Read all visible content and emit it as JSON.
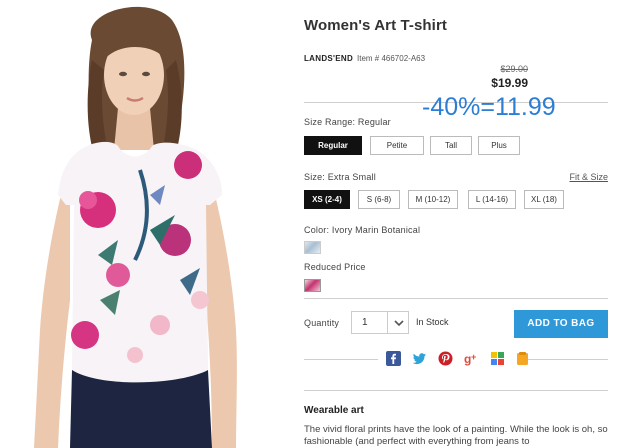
{
  "product": {
    "title": "Women's Art T-shirt",
    "brand": "LANDS'END",
    "item_number": "Item # 466702-A63",
    "original_price": "$29.00",
    "sale_price": "$19.99"
  },
  "overlay": {
    "discount_text": "-40%=11.99",
    "color": "#2b7dd6"
  },
  "size_range": {
    "label": "Size Range: Regular",
    "options": [
      "Regular",
      "Petite",
      "Tall",
      "Plus"
    ],
    "selected": "Regular"
  },
  "size": {
    "label": "Size: Extra Small",
    "fit_link": "Fit & Size",
    "options": [
      "XS (2-4)",
      "S (6-8)",
      "M (10-12)",
      "L (14-16)",
      "XL (18)"
    ],
    "selected": "XS (2-4)"
  },
  "color": {
    "label": "Color: Ivory Marin Botanical",
    "reduced_label": "Reduced Price"
  },
  "purchase": {
    "quantity_label": "Quantity",
    "quantity_value": "1",
    "stock_status": "In Stock",
    "add_to_bag": "ADD TO BAG",
    "button_color": "#2e98d8"
  },
  "social_icons": [
    "facebook-icon",
    "twitter-icon",
    "pinterest-icon",
    "google-plus-icon",
    "share-icon",
    "favorite-icon"
  ],
  "description": {
    "heading": "Wearable art",
    "text": "The vivid floral prints have the look of a painting. While the look is oh, so fashionable (and perfect with everything from jeans to"
  }
}
